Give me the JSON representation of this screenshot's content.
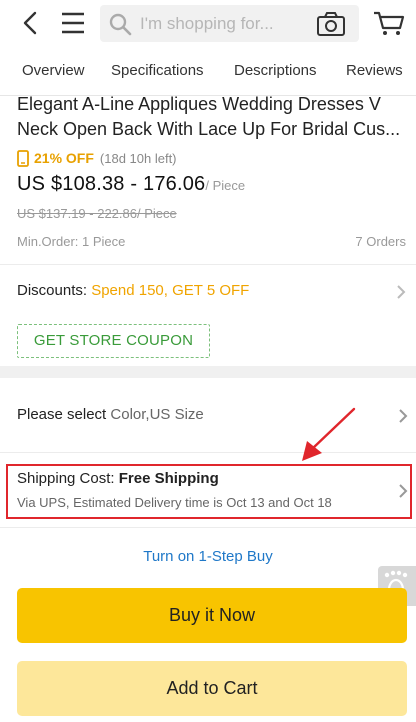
{
  "header": {
    "search_placeholder": "I'm shopping for...",
    "icons": [
      "back-arrow-icon",
      "menu-icon",
      "search-icon",
      "camera-icon",
      "cart-icon"
    ]
  },
  "tabs": [
    {
      "label": "Overview",
      "active": true
    },
    {
      "label": "Specifications",
      "active": false
    },
    {
      "label": "Descriptions",
      "active": false
    },
    {
      "label": "Reviews",
      "active": false
    }
  ],
  "product": {
    "title_line1": "Elegant A-Line Appliques Wedding Dresses V",
    "title_line2": "Neck Open Back With Lace Up For Bridal Cus...",
    "discount_pct": "21% OFF",
    "time_left": "(18d 10h left)",
    "price": "US $108.38 - 176.06",
    "price_unit": "/ Piece",
    "old_price": "US $137.19 - 222.86/ Piece",
    "min_order": "Min.Order: 1  Piece",
    "orders": "7 Orders"
  },
  "discounts": {
    "label": "Discounts: ",
    "value": "Spend 150, GET 5 OFF"
  },
  "coupon_label": "GET STORE COUPON",
  "select": {
    "label": "Please select ",
    "options": "Color,US Size"
  },
  "shipping": {
    "label": "Shipping Cost: ",
    "value": "Free Shipping",
    "detail": "Via UPS, Estimated Delivery time is Oct 13 and Oct 18"
  },
  "one_step_label": "Turn on 1-Step Buy",
  "buy_now_label": "Buy it Now",
  "add_to_cart_label": "Add to Cart",
  "colors": {
    "accent_yellow": "#f8c400",
    "cart_yellow": "#fde79a",
    "discount_orange": "#f0a400",
    "coupon_green": "#3a9b3a",
    "link_blue": "#1f78c8",
    "highlight_red": "#e0262c"
  }
}
